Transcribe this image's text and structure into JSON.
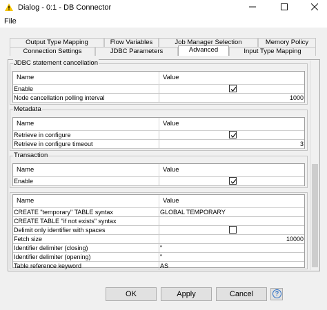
{
  "window": {
    "title": "Dialog - 0:1 - DB Connector",
    "icon": "warning-triangle-icon",
    "buttons": [
      "minimize-icon",
      "maximize-icon",
      "close-icon"
    ]
  },
  "menu": {
    "file": "File"
  },
  "tabs": {
    "row1": [
      "Output Type Mapping",
      "Flow Variables",
      "Job Manager Selection",
      "Memory Policy"
    ],
    "row2": [
      "Connection Settings",
      "JDBC Parameters",
      "Advanced",
      "Input Type Mapping"
    ],
    "active": "Advanced"
  },
  "table_headers": {
    "name": "Name",
    "value": "Value"
  },
  "groups": {
    "cancellation": {
      "title": "JDBC statement cancellation",
      "rows": [
        {
          "name": "Enable",
          "checked": true
        },
        {
          "name": "Node cancellation polling interval",
          "value": "1000"
        }
      ]
    },
    "metadata": {
      "title": "Metadata",
      "rows": [
        {
          "name": "Retrieve in configure",
          "checked": true
        },
        {
          "name": "Retrieve in configure timeout",
          "value": "3"
        }
      ]
    },
    "transaction": {
      "title": "Transaction",
      "rows": [
        {
          "name": "Enable",
          "checked": true
        }
      ]
    },
    "misc": {
      "rows": [
        {
          "name": "CREATE \"temporary\" TABLE syntax",
          "value": "GLOBAL TEMPORARY"
        },
        {
          "name": "CREATE TABLE \"if not exists\" syntax",
          "value": ""
        },
        {
          "name": "Delimit only identifier with spaces",
          "checked": false
        },
        {
          "name": "Fetch size",
          "value": "10000"
        },
        {
          "name": "Identifier delimiter (closing)",
          "value": "\""
        },
        {
          "name": "Identifier delimiter (opening)",
          "value": "\""
        },
        {
          "name": "Table reference keyword",
          "value": "AS"
        }
      ]
    }
  },
  "footer": {
    "ok": "OK",
    "apply": "Apply",
    "cancel": "Cancel",
    "help_icon": "help-icon"
  },
  "colors": {
    "accent": "#2b6fc7",
    "warning": "#f5c400"
  }
}
